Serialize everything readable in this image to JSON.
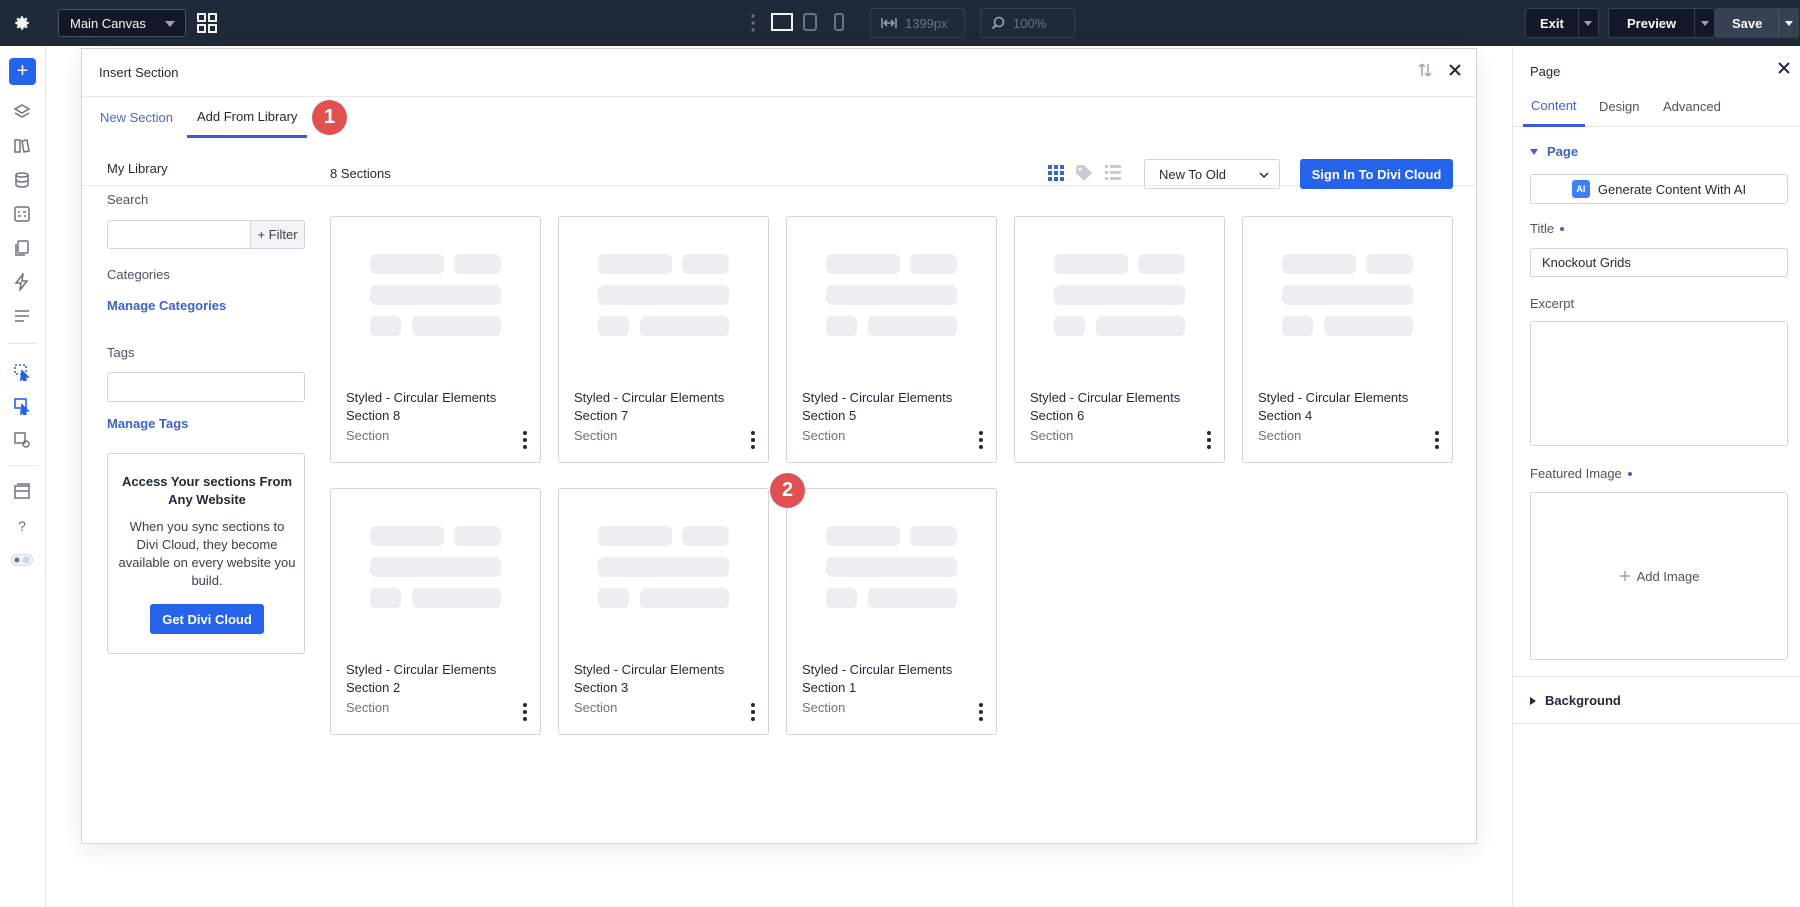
{
  "topbar": {
    "canvas_select": "Main Canvas",
    "width_value": "1399px",
    "zoom_value": "100%",
    "exit_label": "Exit",
    "preview_label": "Preview",
    "save_label": "Save"
  },
  "modal": {
    "title": "Insert Section",
    "tabs": [
      {
        "label": "New Section"
      },
      {
        "label": "Add From Library"
      }
    ],
    "badges": [
      "1",
      "2"
    ]
  },
  "library": {
    "heading": "My Library",
    "search_label": "Search",
    "filter_label": "+ Filter",
    "categories_label": "Categories",
    "manage_categories": "Manage Categories",
    "tags_label": "Tags",
    "manage_tags": "Manage Tags",
    "cloud_promo": {
      "title": "Access Your sections From Any Website",
      "text": "When you sync sections to Divi Cloud, they become available on every website you build.",
      "button": "Get Divi Cloud"
    }
  },
  "grid": {
    "count_label": "8 Sections",
    "sort_value": "New To Old",
    "cloud_button": "Sign In To Divi Cloud",
    "cards": [
      {
        "title": "Styled - Circular Elements Section 8",
        "type": "Section"
      },
      {
        "title": "Styled - Circular Elements Section 7",
        "type": "Section"
      },
      {
        "title": "Styled - Circular Elements Section 5",
        "type": "Section"
      },
      {
        "title": "Styled - Circular Elements Section 6",
        "type": "Section"
      },
      {
        "title": "Styled - Circular Elements Section 4",
        "type": "Section"
      },
      {
        "title": "Styled - Circular Elements Section 2",
        "type": "Section"
      },
      {
        "title": "Styled - Circular Elements Section 3",
        "type": "Section"
      },
      {
        "title": "Styled - Circular Elements Section 1",
        "type": "Section"
      }
    ]
  },
  "panel": {
    "title": "Page",
    "tabs": [
      {
        "label": "Content"
      },
      {
        "label": "Design"
      },
      {
        "label": "Advanced"
      }
    ],
    "section_page": "Page",
    "ai_badge": "AI",
    "ai_button": "Generate Content With AI",
    "title_label": "Title",
    "title_value": "Knockout Grids",
    "excerpt_label": "Excerpt",
    "featured_label": "Featured Image",
    "add_image": "Add Image",
    "background_label": "Background"
  },
  "colors": {
    "topbar": "#1f2937",
    "accent": "#2563eb",
    "link": "#3b64c8",
    "badge": "#e05252"
  }
}
